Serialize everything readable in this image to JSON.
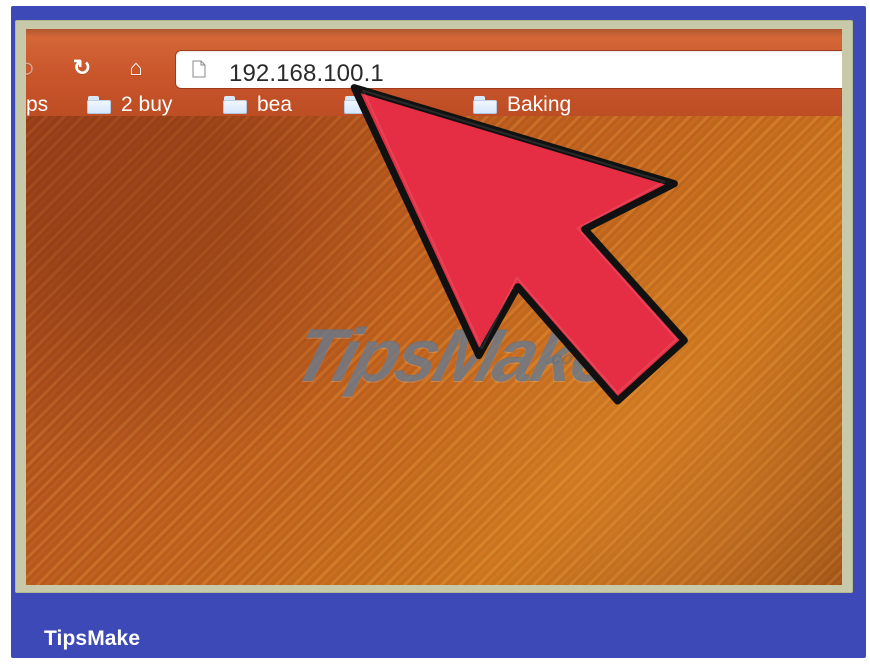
{
  "app": {
    "address_url": "192.168.100.1",
    "footer_brand": "TipsMake",
    "watermark_text": "TipsMake"
  },
  "toolbar": {
    "bookmarks": [
      {
        "label": "ps"
      },
      {
        "label": "2 buy"
      },
      {
        "label": "bea"
      },
      {
        "label": ""
      },
      {
        "label": "Baking"
      }
    ]
  },
  "icons": {
    "back": "back-icon",
    "reload": "reload-icon",
    "home": "home-icon",
    "page": "page-icon",
    "folder": "folder-icon",
    "pointer": "red-arrow-pointer"
  },
  "colors": {
    "card_background": "#3e49b8",
    "toolbar": "#c9552b",
    "arrow_fill": "#e52d43",
    "arrow_outline": "#111111",
    "content_background": "#c3641f"
  }
}
